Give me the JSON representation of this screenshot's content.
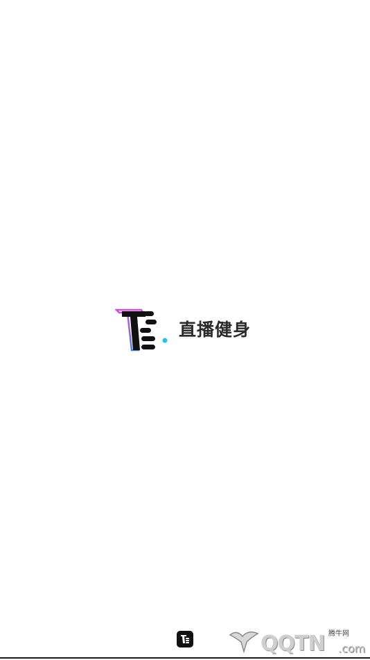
{
  "splash": {
    "app_name": "直播健身",
    "logo_icon": "brand-t-logo-icon"
  },
  "bottom_bar": {
    "app_icon": "brand-t-small-icon"
  },
  "watermark": {
    "tag": "腾牛网",
    "text": "QQTN",
    "suffix": ".com",
    "emblem_icon": "bull-horns-icon"
  },
  "colors": {
    "background": "#ffffff",
    "logo_magenta": "#d44be0",
    "logo_purple": "#7b5cf0",
    "logo_blue": "#4a7cf0",
    "logo_cyan": "#22c3e6",
    "logo_black": "#111111",
    "text": "#2a2a2a"
  }
}
